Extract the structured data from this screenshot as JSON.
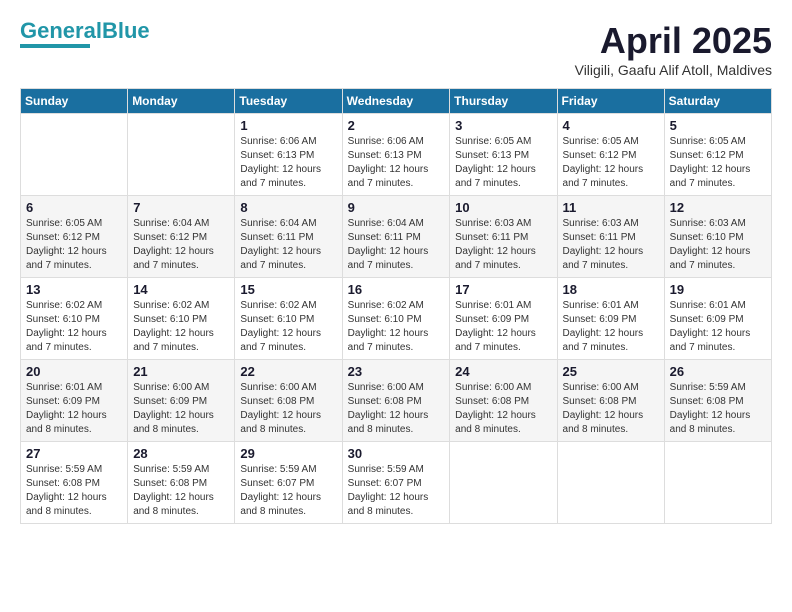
{
  "header": {
    "logo_general": "General",
    "logo_blue": "Blue",
    "month_title": "April 2025",
    "subtitle": "Viligili, Gaafu Alif Atoll, Maldives"
  },
  "days_of_week": [
    "Sunday",
    "Monday",
    "Tuesday",
    "Wednesday",
    "Thursday",
    "Friday",
    "Saturday"
  ],
  "weeks": [
    [
      {
        "num": "",
        "info": ""
      },
      {
        "num": "",
        "info": ""
      },
      {
        "num": "1",
        "info": "Sunrise: 6:06 AM\nSunset: 6:13 PM\nDaylight: 12 hours and 7 minutes."
      },
      {
        "num": "2",
        "info": "Sunrise: 6:06 AM\nSunset: 6:13 PM\nDaylight: 12 hours and 7 minutes."
      },
      {
        "num": "3",
        "info": "Sunrise: 6:05 AM\nSunset: 6:13 PM\nDaylight: 12 hours and 7 minutes."
      },
      {
        "num": "4",
        "info": "Sunrise: 6:05 AM\nSunset: 6:12 PM\nDaylight: 12 hours and 7 minutes."
      },
      {
        "num": "5",
        "info": "Sunrise: 6:05 AM\nSunset: 6:12 PM\nDaylight: 12 hours and 7 minutes."
      }
    ],
    [
      {
        "num": "6",
        "info": "Sunrise: 6:05 AM\nSunset: 6:12 PM\nDaylight: 12 hours and 7 minutes."
      },
      {
        "num": "7",
        "info": "Sunrise: 6:04 AM\nSunset: 6:12 PM\nDaylight: 12 hours and 7 minutes."
      },
      {
        "num": "8",
        "info": "Sunrise: 6:04 AM\nSunset: 6:11 PM\nDaylight: 12 hours and 7 minutes."
      },
      {
        "num": "9",
        "info": "Sunrise: 6:04 AM\nSunset: 6:11 PM\nDaylight: 12 hours and 7 minutes."
      },
      {
        "num": "10",
        "info": "Sunrise: 6:03 AM\nSunset: 6:11 PM\nDaylight: 12 hours and 7 minutes."
      },
      {
        "num": "11",
        "info": "Sunrise: 6:03 AM\nSunset: 6:11 PM\nDaylight: 12 hours and 7 minutes."
      },
      {
        "num": "12",
        "info": "Sunrise: 6:03 AM\nSunset: 6:10 PM\nDaylight: 12 hours and 7 minutes."
      }
    ],
    [
      {
        "num": "13",
        "info": "Sunrise: 6:02 AM\nSunset: 6:10 PM\nDaylight: 12 hours and 7 minutes."
      },
      {
        "num": "14",
        "info": "Sunrise: 6:02 AM\nSunset: 6:10 PM\nDaylight: 12 hours and 7 minutes."
      },
      {
        "num": "15",
        "info": "Sunrise: 6:02 AM\nSunset: 6:10 PM\nDaylight: 12 hours and 7 minutes."
      },
      {
        "num": "16",
        "info": "Sunrise: 6:02 AM\nSunset: 6:10 PM\nDaylight: 12 hours and 7 minutes."
      },
      {
        "num": "17",
        "info": "Sunrise: 6:01 AM\nSunset: 6:09 PM\nDaylight: 12 hours and 7 minutes."
      },
      {
        "num": "18",
        "info": "Sunrise: 6:01 AM\nSunset: 6:09 PM\nDaylight: 12 hours and 7 minutes."
      },
      {
        "num": "19",
        "info": "Sunrise: 6:01 AM\nSunset: 6:09 PM\nDaylight: 12 hours and 7 minutes."
      }
    ],
    [
      {
        "num": "20",
        "info": "Sunrise: 6:01 AM\nSunset: 6:09 PM\nDaylight: 12 hours and 8 minutes."
      },
      {
        "num": "21",
        "info": "Sunrise: 6:00 AM\nSunset: 6:09 PM\nDaylight: 12 hours and 8 minutes."
      },
      {
        "num": "22",
        "info": "Sunrise: 6:00 AM\nSunset: 6:08 PM\nDaylight: 12 hours and 8 minutes."
      },
      {
        "num": "23",
        "info": "Sunrise: 6:00 AM\nSunset: 6:08 PM\nDaylight: 12 hours and 8 minutes."
      },
      {
        "num": "24",
        "info": "Sunrise: 6:00 AM\nSunset: 6:08 PM\nDaylight: 12 hours and 8 minutes."
      },
      {
        "num": "25",
        "info": "Sunrise: 6:00 AM\nSunset: 6:08 PM\nDaylight: 12 hours and 8 minutes."
      },
      {
        "num": "26",
        "info": "Sunrise: 5:59 AM\nSunset: 6:08 PM\nDaylight: 12 hours and 8 minutes."
      }
    ],
    [
      {
        "num": "27",
        "info": "Sunrise: 5:59 AM\nSunset: 6:08 PM\nDaylight: 12 hours and 8 minutes."
      },
      {
        "num": "28",
        "info": "Sunrise: 5:59 AM\nSunset: 6:08 PM\nDaylight: 12 hours and 8 minutes."
      },
      {
        "num": "29",
        "info": "Sunrise: 5:59 AM\nSunset: 6:07 PM\nDaylight: 12 hours and 8 minutes."
      },
      {
        "num": "30",
        "info": "Sunrise: 5:59 AM\nSunset: 6:07 PM\nDaylight: 12 hours and 8 minutes."
      },
      {
        "num": "",
        "info": ""
      },
      {
        "num": "",
        "info": ""
      },
      {
        "num": "",
        "info": ""
      }
    ]
  ]
}
